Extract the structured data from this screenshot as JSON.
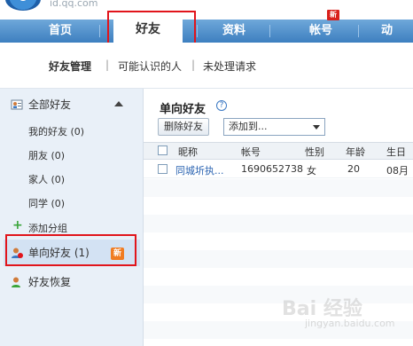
{
  "site": {
    "url": "id.qq.com"
  },
  "nav": {
    "items": [
      {
        "label": "首页"
      },
      {
        "label": "好友"
      },
      {
        "label": "资料"
      },
      {
        "label": "帐号"
      },
      {
        "label": "动"
      }
    ],
    "active_index": 1,
    "badge": "新"
  },
  "subnav": {
    "items": [
      "好友管理",
      "可能认识的人",
      "未处理请求"
    ],
    "separator": "|"
  },
  "sidebar": {
    "all_friends": {
      "label": "全部好友"
    },
    "groups": [
      {
        "label": "我的好友 (0)"
      },
      {
        "label": "朋友 (0)"
      },
      {
        "label": "家人 (0)"
      },
      {
        "label": "同学 (0)"
      }
    ],
    "add_group": "添加分组",
    "one_way": {
      "label": "单向好友 (1)",
      "badge": "新"
    },
    "recover": "好友恢复"
  },
  "main": {
    "title": "单向好友",
    "delete_button": "删除好友",
    "add_to_select": "添加到...",
    "columns": [
      "昵称",
      "帐号",
      "性别",
      "年龄",
      "生日"
    ],
    "rows": [
      {
        "nickname": "同城圻执...",
        "account": "1690652738",
        "gender": "女",
        "age": "20",
        "birthday": "08月"
      }
    ]
  },
  "watermark": {
    "text": "Bai 经验",
    "sub": "jingyan.baidu.com"
  },
  "colors": {
    "nav": "#3d7fc0",
    "highlight": "#e1141b",
    "badge_orange": "#f07c22",
    "link": "#2a63b1"
  }
}
